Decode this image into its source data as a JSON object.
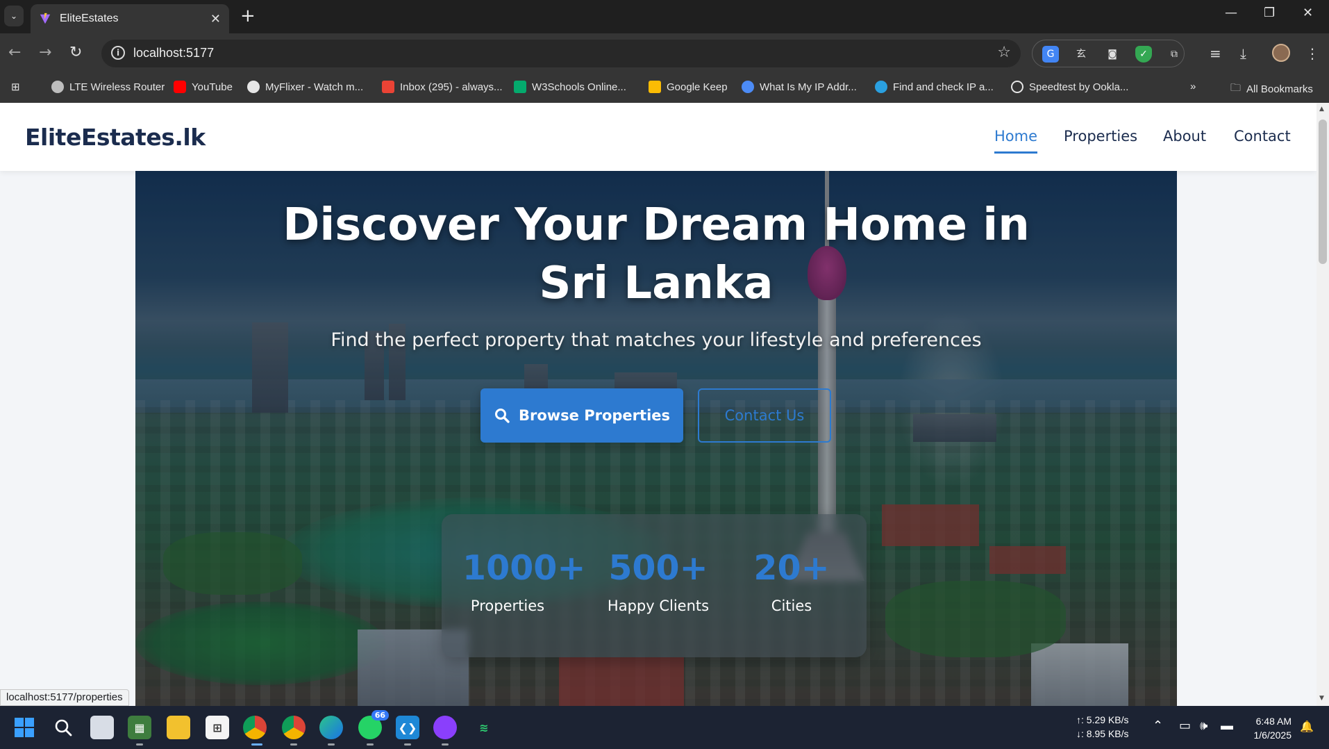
{
  "browser": {
    "tab_title": "EliteEstates",
    "url": "localhost:5177",
    "status_url": "localhost:5177/properties",
    "bookmarks": [
      {
        "label": "LTE Wireless Router",
        "icon": "globe-icon",
        "color": "#bdbdbd"
      },
      {
        "label": "YouTube",
        "icon": "youtube-icon",
        "color": "#ff0000"
      },
      {
        "label": "MyFlixer - Watch m...",
        "icon": "film-icon",
        "color": "#e6e6e6"
      },
      {
        "label": "Inbox (295) - always...",
        "icon": "gmail-icon",
        "color": "#ea4335"
      },
      {
        "label": "W3Schools Online...",
        "icon": "w3schools-icon",
        "color": "#04aa6d"
      },
      {
        "label": "Google Keep",
        "icon": "keep-icon",
        "color": "#fbbc04"
      },
      {
        "label": "What Is My IP Addr...",
        "icon": "globe-icon",
        "color": "#4c8bf5"
      },
      {
        "label": "Find and check IP a...",
        "icon": "w-icon",
        "color": "#2aa0e0"
      },
      {
        "label": "Speedtest by Ookla...",
        "icon": "speedometer-icon",
        "color": "#e6e6e6"
      }
    ],
    "all_bookmarks": "All Bookmarks"
  },
  "site": {
    "logo": "EliteEstates.lk",
    "nav": [
      {
        "label": "Home",
        "active": true
      },
      {
        "label": "Properties",
        "active": false
      },
      {
        "label": "About",
        "active": false
      },
      {
        "label": "Contact",
        "active": false
      }
    ]
  },
  "hero": {
    "title_line1": "Discover Your Dream Home in",
    "title_line2": "Sri Lanka",
    "subtitle": "Find the perfect property that matches your lifestyle and preferences",
    "primary_button": "Browse Properties",
    "secondary_button": "Contact Us",
    "stats": [
      {
        "value": "1000+",
        "label": "Properties"
      },
      {
        "value": "500+",
        "label": "Happy Clients"
      },
      {
        "value": "20+",
        "label": "Cities"
      }
    ]
  },
  "taskbar": {
    "net_up": "↑: 5.29 KB/s",
    "net_down": "↓: 8.95 KB/s",
    "time": "6:48 AM",
    "date": "1/6/2025",
    "whatsapp_badge": "66"
  },
  "colors": {
    "accent": "#2d7ad0",
    "brand_dark": "#1b2c4e"
  }
}
